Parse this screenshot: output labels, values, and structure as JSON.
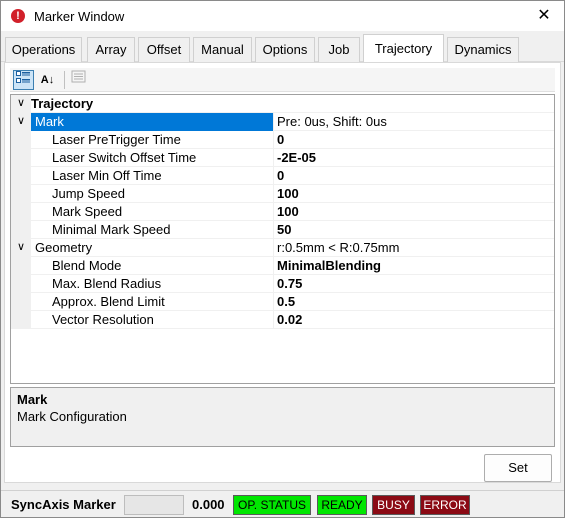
{
  "window": {
    "title": "Marker Window",
    "close_glyph": "✕",
    "icon": "error-icon"
  },
  "tabs": [
    {
      "label": "Operations",
      "active": false
    },
    {
      "label": "Array",
      "active": false
    },
    {
      "label": "Offset",
      "active": false
    },
    {
      "label": "Manual",
      "active": false
    },
    {
      "label": "Options",
      "active": false
    },
    {
      "label": "Job",
      "active": false
    },
    {
      "label": "Trajectory",
      "active": true
    },
    {
      "label": "Dynamics",
      "active": false
    }
  ],
  "toolbar": {
    "categorized_icon": "categorized-view-icon",
    "alphabetical_icon": "sort-alphabetical-icon",
    "property_pages_icon": "property-pages-icon",
    "alpha_glyph": "A↓"
  },
  "grid": {
    "category": "Trajectory",
    "rows": [
      {
        "name": "Mark",
        "value": "Pre: 0us, Shift: 0us",
        "type": "group",
        "selected": true
      },
      {
        "name": "Laser PreTrigger Time",
        "value": "0",
        "type": "prop"
      },
      {
        "name": "Laser Switch Offset Time",
        "value": "-2E-05",
        "type": "prop"
      },
      {
        "name": "Laser Min Off Time",
        "value": "0",
        "type": "prop"
      },
      {
        "name": "Jump Speed",
        "value": "100",
        "type": "prop"
      },
      {
        "name": "Mark Speed",
        "value": "100",
        "type": "prop"
      },
      {
        "name": "Minimal Mark Speed",
        "value": "50",
        "type": "prop"
      },
      {
        "name": "Geometry",
        "value": "r:0.5mm < R:0.75mm",
        "type": "group",
        "selected": false
      },
      {
        "name": "Blend Mode",
        "value": "MinimalBlending",
        "type": "prop"
      },
      {
        "name": "Max. Blend Radius",
        "value": "0.75",
        "type": "prop"
      },
      {
        "name": "Approx. Blend Limit",
        "value": "0.5",
        "type": "prop"
      },
      {
        "name": "Vector Resolution",
        "value": "0.02",
        "type": "prop"
      }
    ]
  },
  "description": {
    "title": "Mark",
    "text": "Mark Configuration"
  },
  "set_button": "Set",
  "status": {
    "label": "SyncAxis Marker",
    "value": "0.000",
    "chips": [
      {
        "label": "OP. STATUS",
        "bg": "#00e600",
        "color": "#000000"
      },
      {
        "label": "READY",
        "bg": "#00e600",
        "color": "#000000"
      },
      {
        "label": "BUSY",
        "bg": "#8b0a14",
        "color": "#ffffff"
      },
      {
        "label": "ERROR",
        "bg": "#8b0a14",
        "color": "#ffffff"
      }
    ]
  }
}
